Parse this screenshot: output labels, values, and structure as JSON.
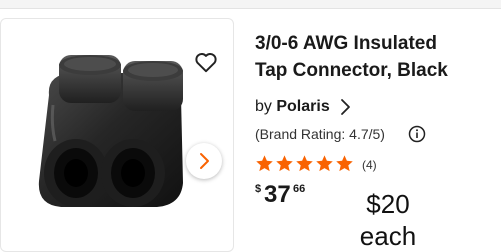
{
  "product": {
    "title_line1": "3/0-6 AWG Insulated",
    "title_line2": "Tap Connector, Black",
    "by_prefix": "by",
    "brand": "Polaris",
    "brand_rating": "(Brand Rating: 4.7/5)",
    "stars": 5,
    "star_color": "#f96302",
    "review_count": "(4)",
    "price": {
      "currency": "$",
      "dollars": "37",
      "cents": "66"
    }
  },
  "annotation": {
    "line1": "$20",
    "line2": "each"
  }
}
